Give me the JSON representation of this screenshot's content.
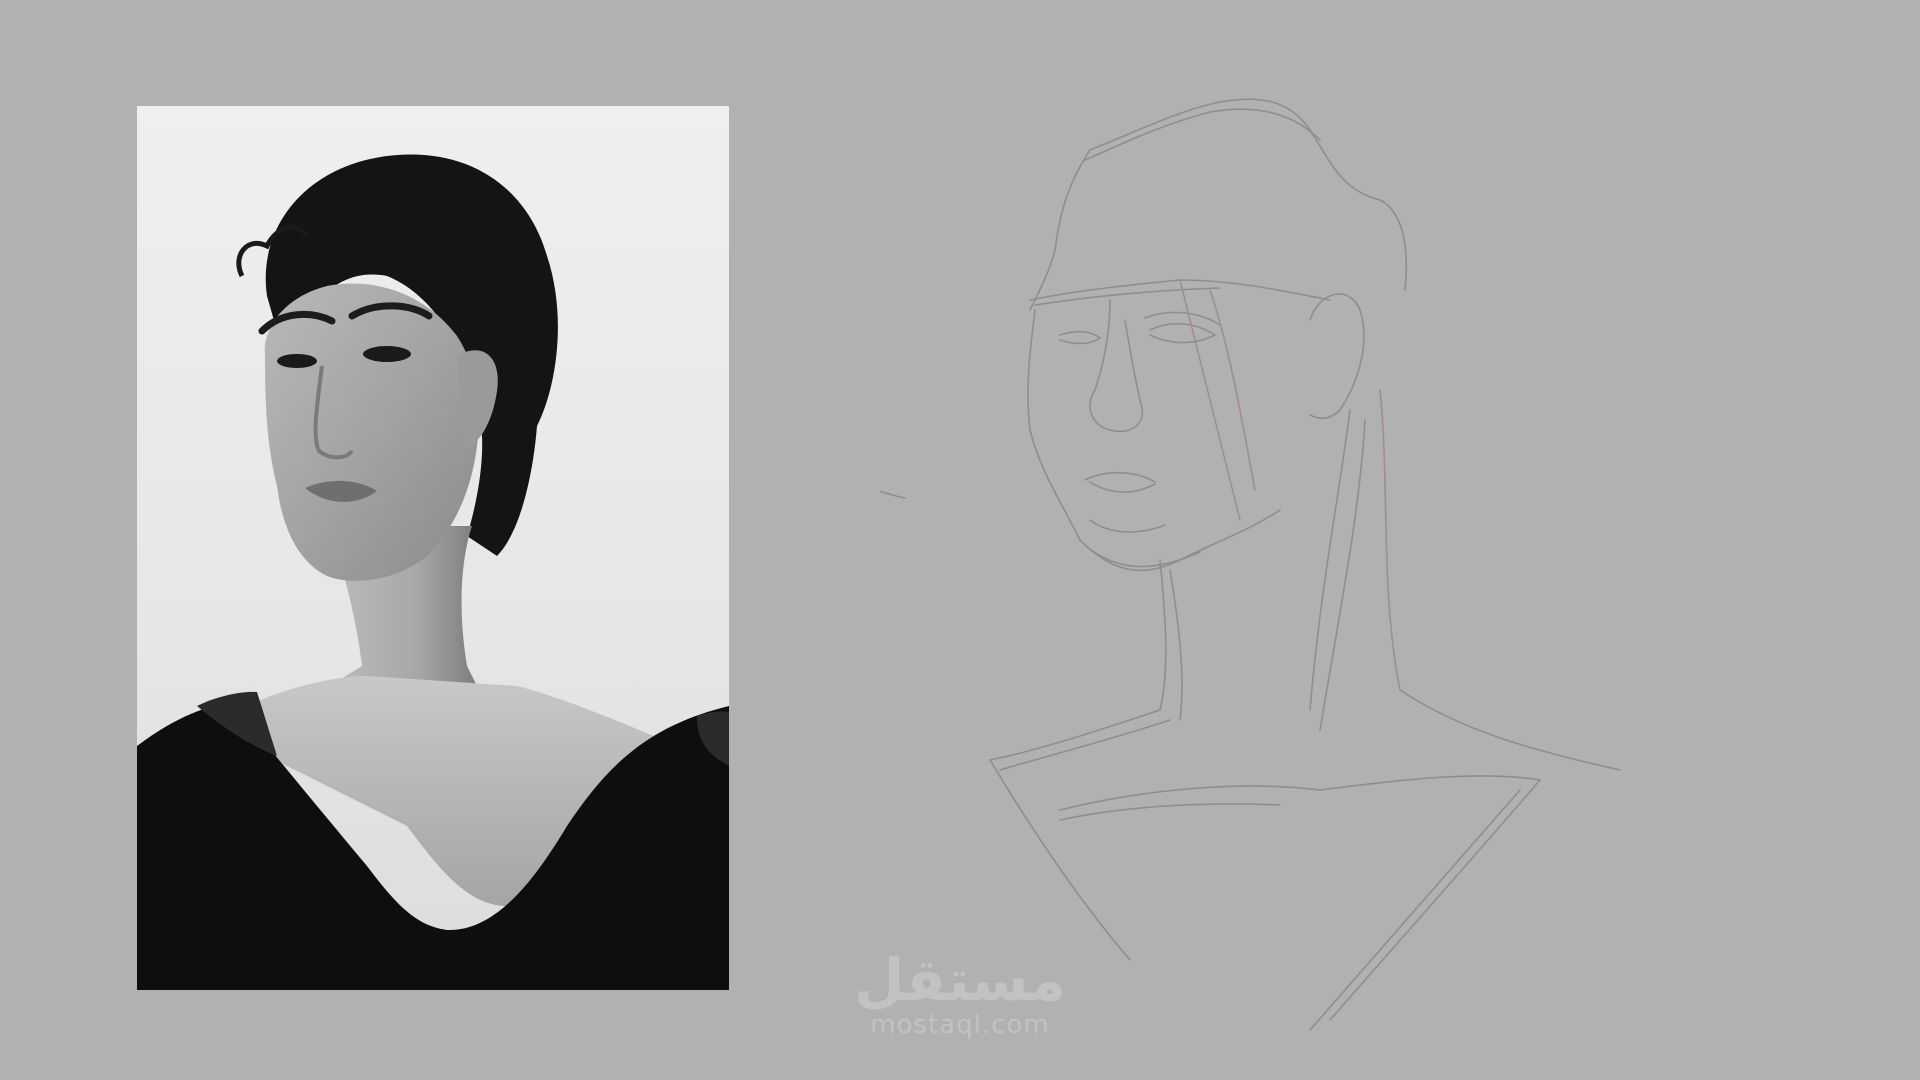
{
  "watermark": {
    "arabic": "مستقل",
    "latin": "mostaql.com"
  },
  "colors": {
    "background": "#b1b1b1",
    "sketch_stroke": "#8a8a8a",
    "sketch_accent": "#9a8f96",
    "watermark": "#c4c4c4"
  }
}
